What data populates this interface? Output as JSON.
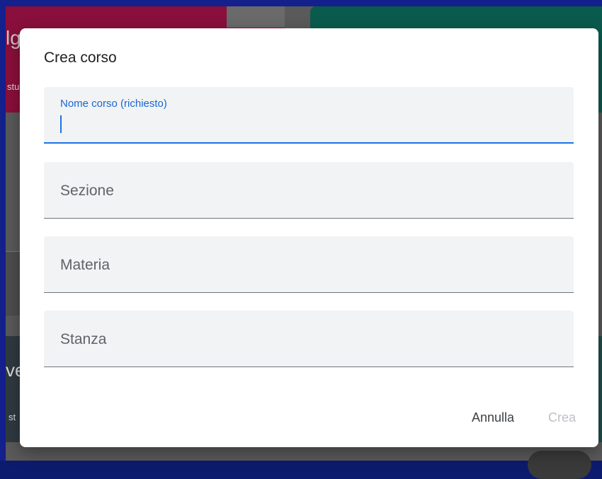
{
  "background": {
    "card1_fragment": "lg",
    "card1_sub_fragment": "stu",
    "card3_fragment": "ve",
    "card3_sub_fragment": "st"
  },
  "dialog": {
    "title": "Crea corso",
    "fields": {
      "name": {
        "label": "Nome corso (richiesto)",
        "value": ""
      },
      "section": {
        "label": "Sezione"
      },
      "subject": {
        "label": "Materia"
      },
      "room": {
        "label": "Stanza"
      }
    },
    "actions": {
      "cancel_label": "Annulla",
      "create_label": "Crea"
    }
  },
  "colors": {
    "accent": "#1a73e8",
    "dialog_background": "#ffffff",
    "field_background": "#f1f3f4",
    "disabled_text": "#bdc1c6"
  }
}
